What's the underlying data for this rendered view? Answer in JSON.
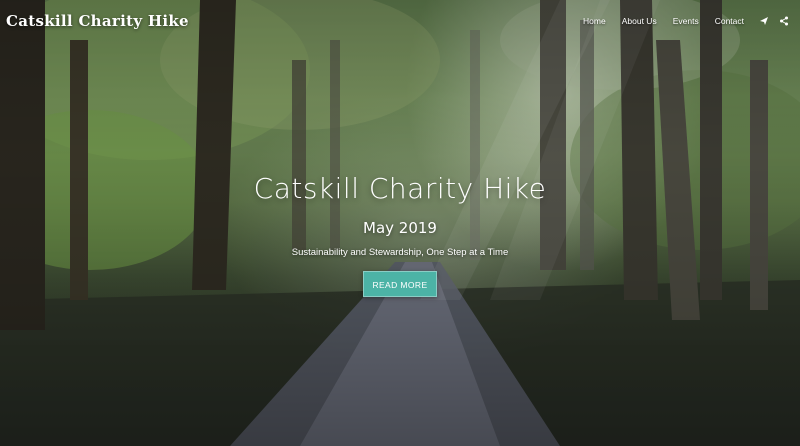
{
  "brand": {
    "name": "Catskill Charity Hike"
  },
  "nav": {
    "items": [
      {
        "label": "Home"
      },
      {
        "label": "About Us"
      },
      {
        "label": "Events"
      },
      {
        "label": "Contact"
      }
    ],
    "icons": [
      "send-icon",
      "share-icon"
    ]
  },
  "hero": {
    "title": "Catskill Charity Hike",
    "date": "May 2019",
    "tagline": "Sustainability and Stewardship, One Step at a Time",
    "button_label": "READ MORE"
  },
  "colors": {
    "accent": "#4cb3a6",
    "text": "#ffffff"
  }
}
